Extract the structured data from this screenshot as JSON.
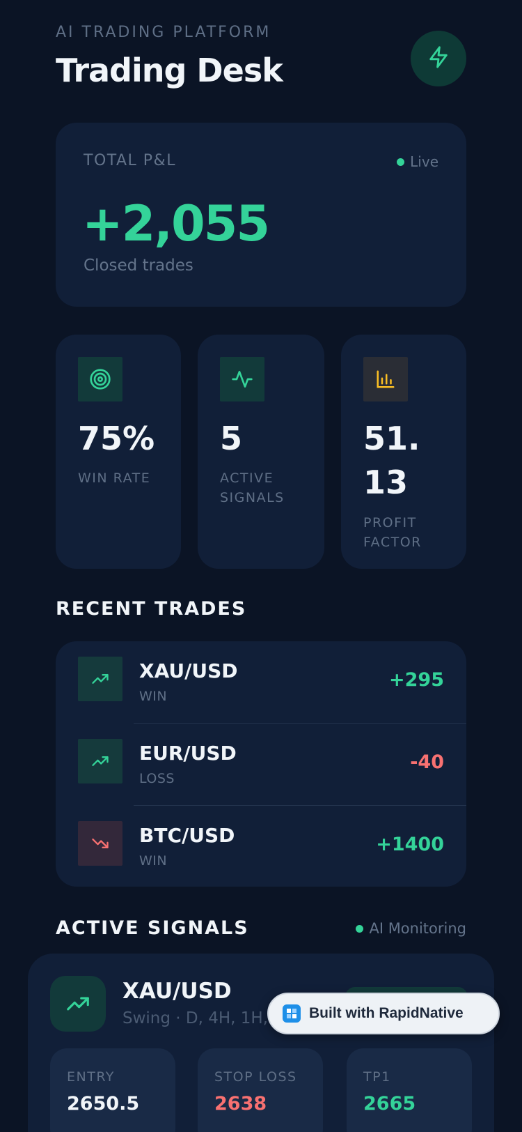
{
  "header": {
    "eyebrow": "AI TRADING PLATFORM",
    "title": "Trading Desk",
    "action_icon": "bolt-icon"
  },
  "pnl": {
    "label": "TOTAL P&L",
    "status": "Live",
    "value": "+2,055",
    "subtitle": "Closed trades"
  },
  "stats": [
    {
      "icon": "target-icon",
      "value": "75%",
      "label": "WIN RATE"
    },
    {
      "icon": "activity-icon",
      "value": "5",
      "label": "ACTIVE SIGNALS"
    },
    {
      "icon": "bar-chart-icon",
      "value": "51.13",
      "label": "PROFIT FACTOR"
    }
  ],
  "recent_trades": {
    "title": "RECENT TRADES",
    "items": [
      {
        "pair": "XAU/USD",
        "status": "WIN",
        "pnl": "+295",
        "icon": "trending-up-icon"
      },
      {
        "pair": "EUR/USD",
        "status": "LOSS",
        "pnl": "-40",
        "icon": "trending-up-icon"
      },
      {
        "pair": "BTC/USD",
        "status": "WIN",
        "pnl": "+1400",
        "icon": "trending-down-icon"
      }
    ]
  },
  "active_signals": {
    "title": "ACTIVE SIGNALS",
    "status": "AI Monitoring",
    "signal": {
      "pair": "XAU/USD",
      "meta": "Swing · D, 4H, 1H, 3",
      "levels": [
        {
          "label": "ENTRY",
          "value": "2650.5"
        },
        {
          "label": "STOP LOSS",
          "value": "2638"
        },
        {
          "label": "TP1",
          "value": "2665"
        }
      ]
    }
  },
  "badge": {
    "text": "Built with RapidNative"
  },
  "colors": {
    "background": "#0b1425",
    "card": "#111f38",
    "positive": "#34d399",
    "negative": "#f87171",
    "warning": "#fbbf24",
    "muted": "#64748b"
  }
}
